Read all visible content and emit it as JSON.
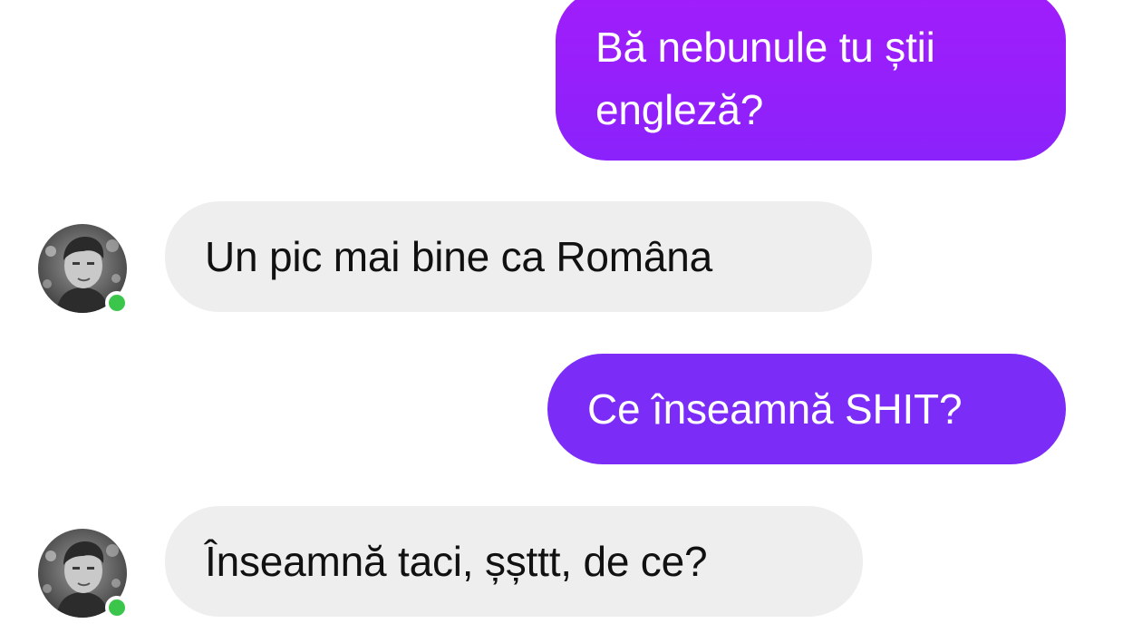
{
  "messages": [
    {
      "sender": "me",
      "text": "Bă nebunule tu știi engleză?"
    },
    {
      "sender": "contact",
      "text": "Un pic mai bine ca Romȃna"
    },
    {
      "sender": "me",
      "text": "Ce înseamnă SHIT?"
    },
    {
      "sender": "contact",
      "text": "Înseamnă taci, șșttt, de ce?"
    }
  ],
  "contact": {
    "avatar_icon": "profile-photo",
    "presence": "online",
    "presence_color": "#3bc64b"
  },
  "colors": {
    "outgoing_bubble": "#8b22fb",
    "outgoing_bubble_alt": "#7b2cf7",
    "incoming_bubble": "#eeeeee",
    "incoming_text": "#111111",
    "background": "#ffffff"
  }
}
